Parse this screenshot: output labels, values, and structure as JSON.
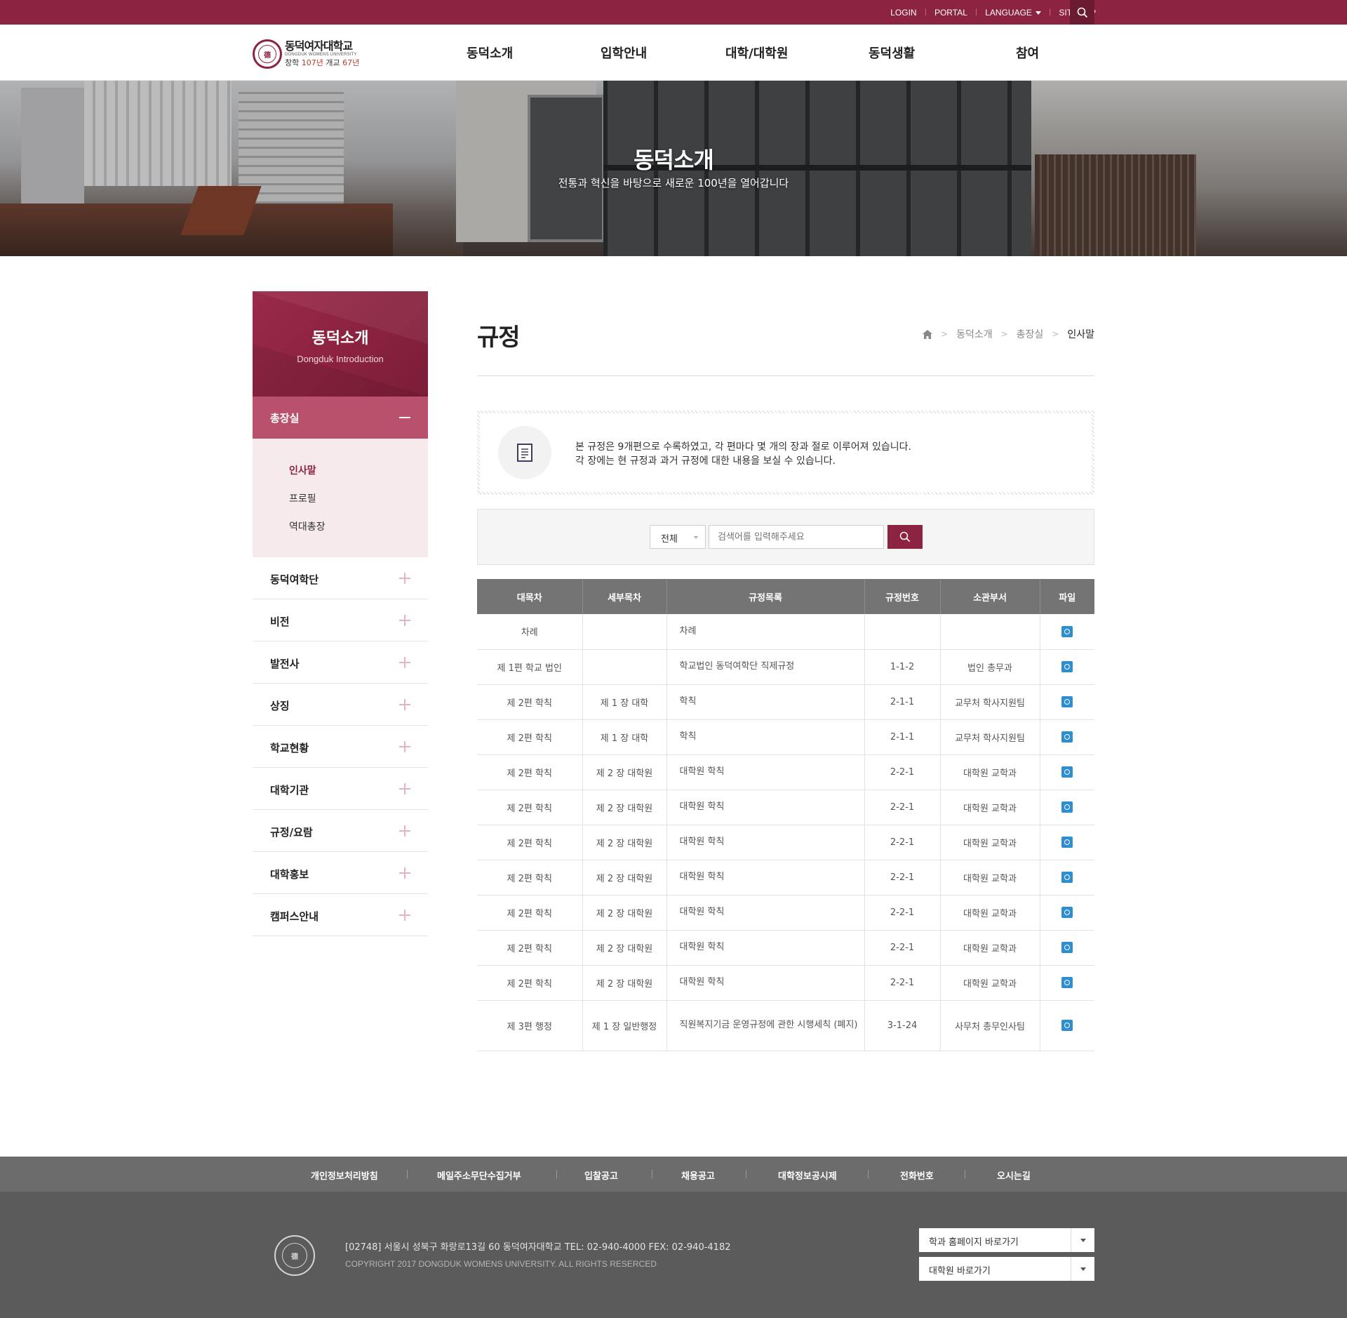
{
  "utility": {
    "links": [
      "LOGIN",
      "PORTAL",
      "LANGUAGE",
      "SITEMAP"
    ]
  },
  "logo": {
    "name": "동덕여자대학교",
    "eng": "DONGDUK WOMENS UNIVERSITY",
    "since_a": "창학 ",
    "since_b": "107년",
    "since_c": " 개교 ",
    "since_d": "67년"
  },
  "gnb": [
    "동덕소개",
    "입학안내",
    "대학/대학원",
    "동덕생활",
    "참여"
  ],
  "hero": {
    "title": "동덕소개",
    "subtitle": "전통과 혁신을 바탕으로 새로운 100년을 열어갑니다"
  },
  "sidebar": {
    "title": "동덕소개",
    "title_en": "Dongduk Introduction",
    "active": "총장실",
    "sub": [
      "인사말",
      "프로필",
      "역대총장"
    ],
    "items": [
      "동덕여학단",
      "비전",
      "발전사",
      "상징",
      "학교현황",
      "대학기관",
      "규정/요람",
      "대학홍보",
      "캠퍼스안내"
    ]
  },
  "content": {
    "title": "규정",
    "breadcrumb": [
      "동덕소개",
      "총장실",
      "인사말"
    ],
    "notice": [
      "본 규정은 9개편으로 수록하였고, 각 편마다 몇 개의 장과 절로 이루어져 있습니다.",
      "각 장에는 현 규정과 과거 규정에 대한 내용을 보실 수 있습니다."
    ],
    "search": {
      "select": "전체",
      "placeholder": "검색어를 입력해주세요"
    },
    "table": {
      "headers": [
        "대목차",
        "세부목차",
        "규정목록",
        "규정번호",
        "소관부서",
        "파일"
      ],
      "rows": [
        [
          "차례",
          "",
          "차례",
          "",
          ""
        ],
        [
          "제 1편 학교 법인",
          "",
          "학교법인 동덕여학단 직제규정",
          "1-1-2",
          "법인 총무과"
        ],
        [
          "제 2편 학칙",
          "제 1 장 대학",
          "학칙",
          "2-1-1",
          "교무처 학사지원팀"
        ],
        [
          "제 2편 학칙",
          "제 1 장 대학",
          "학칙",
          "2-1-1",
          "교무처 학사지원팀"
        ],
        [
          "제 2편 학칙",
          "제 2 장 대학원",
          "대학원 학칙",
          "2-2-1",
          "대학원 교학과"
        ],
        [
          "제 2편 학칙",
          "제 2 장 대학원",
          "대학원 학칙",
          "2-2-1",
          "대학원 교학과"
        ],
        [
          "제 2편 학칙",
          "제 2 장 대학원",
          "대학원 학칙",
          "2-2-1",
          "대학원 교학과"
        ],
        [
          "제 2편 학칙",
          "제 2 장 대학원",
          "대학원 학칙",
          "2-2-1",
          "대학원 교학과"
        ],
        [
          "제 2편 학칙",
          "제 2 장 대학원",
          "대학원 학칙",
          "2-2-1",
          "대학원 교학과"
        ],
        [
          "제 2편 학칙",
          "제 2 장 대학원",
          "대학원 학칙",
          "2-2-1",
          "대학원 교학과"
        ],
        [
          "제 2편 학칙",
          "제 2 장 대학원",
          "대학원 학칙",
          "2-2-1",
          "대학원 교학과"
        ],
        [
          "제 3편 행정",
          "제 1 장 일반행정",
          "직원복지기금 운영규정에 관한 시행세칙 (폐지)",
          "3-1-24",
          "사무처 총무인사팀"
        ]
      ]
    }
  },
  "footer": {
    "nav": [
      "개인정보처리방침",
      "메일주소무단수집거부",
      "입찰공고",
      "채용공고",
      "대학정보공시제",
      "전화번호",
      "오시는길"
    ],
    "address": "[02748] 서울시 성북구 화랑로13길 60 동덕여자대학교   TEL: 02-940-4000  FEX: 02-940-4182",
    "copyright": "COPYRIGHT 2017 DONGDUK WOMENS UNIVERSITY. ALL RIGHTS RESERCED",
    "dropdowns": [
      "학과 홈페이지 바로가기",
      "대학원 바로가기"
    ]
  },
  "colors": {
    "brand": "#8c2340",
    "sidebar_active": "#b9516c",
    "table_header": "#747474",
    "file_icon": "#2e8ed0"
  }
}
